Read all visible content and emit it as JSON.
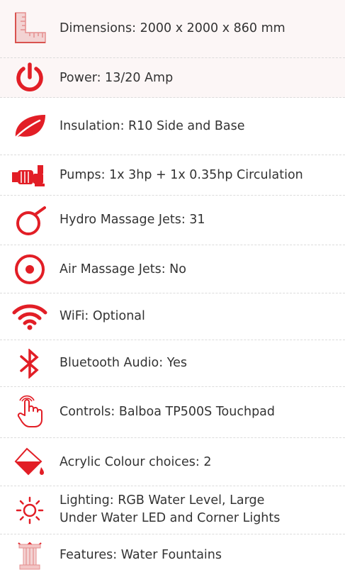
{
  "colors": {
    "accent": "#e21e26",
    "text": "#333333",
    "divider": "#dcdcdc"
  },
  "specs": [
    {
      "icon": "ruler-icon",
      "text": "Dimensions: 2000 x 2000 x 860 mm"
    },
    {
      "icon": "power-icon",
      "text": "Power: 13/20 Amp"
    },
    {
      "icon": "leaf-icon",
      "text": "Insulation: R10 Side and Base"
    },
    {
      "icon": "pump-icon",
      "text": "Pumps: 1x 3hp + 1x 0.35hp Circulation"
    },
    {
      "icon": "jet-ring-icon",
      "text": "Hydro Massage Jets: 31"
    },
    {
      "icon": "target-icon",
      "text": "Air Massage Jets: No"
    },
    {
      "icon": "wifi-icon",
      "text": "WiFi: Optional"
    },
    {
      "icon": "bluetooth-icon",
      "text": "Bluetooth Audio: Yes"
    },
    {
      "icon": "touch-hand-icon",
      "text": "Controls: Balboa TP500S Touchpad"
    },
    {
      "icon": "paint-bucket-icon",
      "text": "Acrylic Colour choices: 2"
    },
    {
      "icon": "sun-icon",
      "text_line1": "Lighting: RGB Water Level, Large",
      "text_line2": "Under Water LED and Corner Lights"
    },
    {
      "icon": "fountain-icon",
      "text": "Features: Water Fountains"
    }
  ]
}
